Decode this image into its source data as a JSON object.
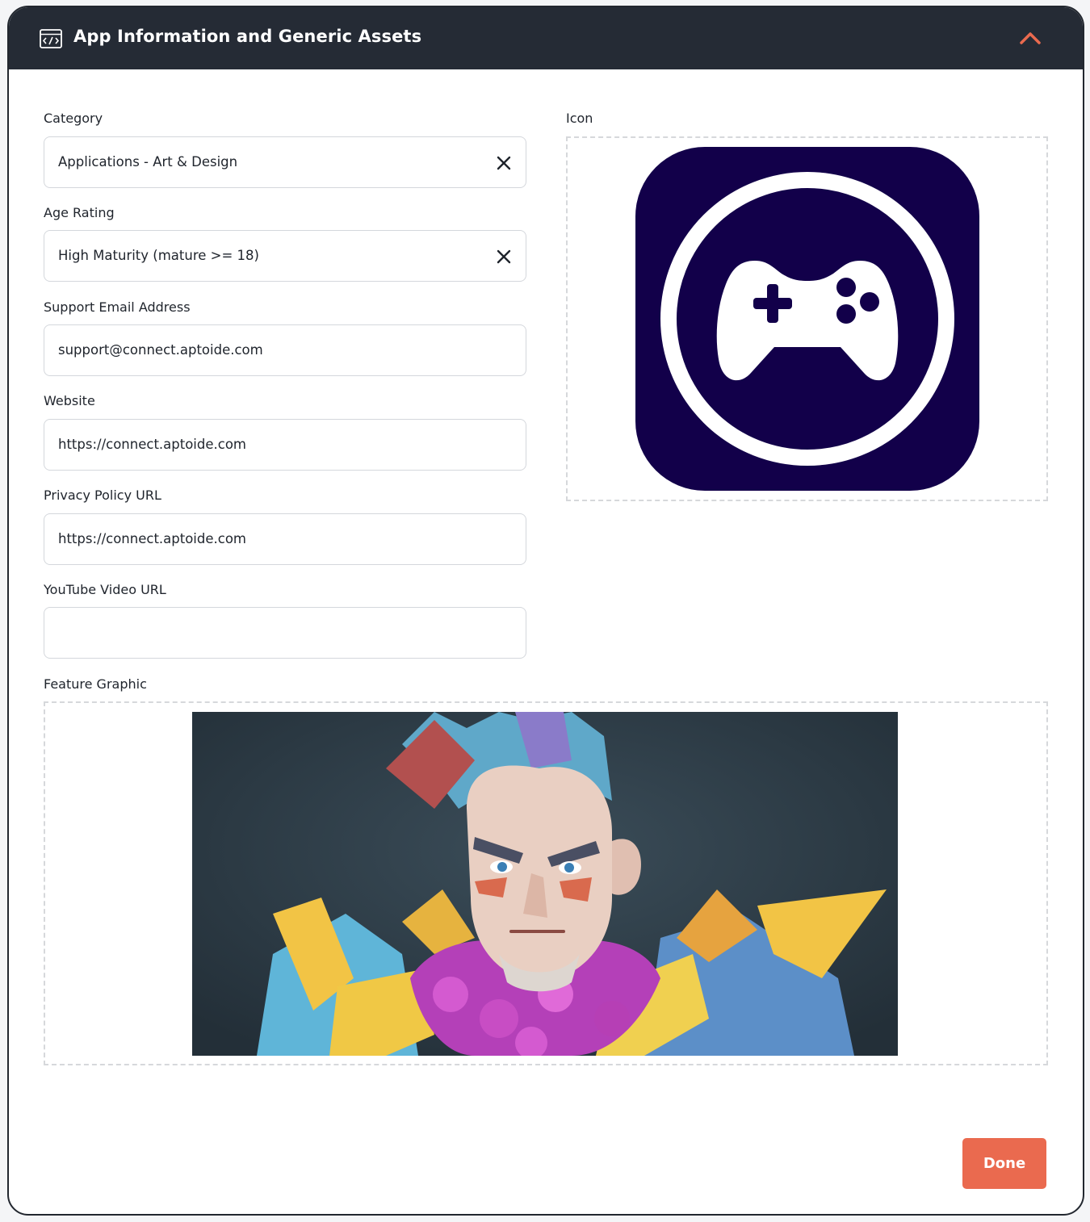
{
  "header": {
    "title": "App Information and Generic Assets",
    "section_icon": "code-window-icon",
    "collapse_icon": "chevron-up-icon"
  },
  "form": {
    "category": {
      "label": "Category",
      "value": "Applications - Art & Design"
    },
    "age_rating": {
      "label": "Age Rating",
      "value": "High Maturity (mature >= 18)"
    },
    "support_email": {
      "label": "Support Email Address",
      "value": "support@connect.aptoide.com"
    },
    "website": {
      "label": "Website",
      "value": "https://connect.aptoide.com"
    },
    "privacy_policy": {
      "label": "Privacy Policy URL",
      "value": "https://connect.aptoide.com"
    },
    "youtube": {
      "label": "YouTube Video URL",
      "value": ""
    }
  },
  "icon_section": {
    "label": "Icon",
    "image": "gamepad-app-icon"
  },
  "feature_section": {
    "label": "Feature Graphic",
    "image": "warrior-character-illustration"
  },
  "actions": {
    "done_label": "Done"
  },
  "colors": {
    "header_bg": "#252b35",
    "accent": "#ea6a4f",
    "icon_bg": "#12004a"
  }
}
